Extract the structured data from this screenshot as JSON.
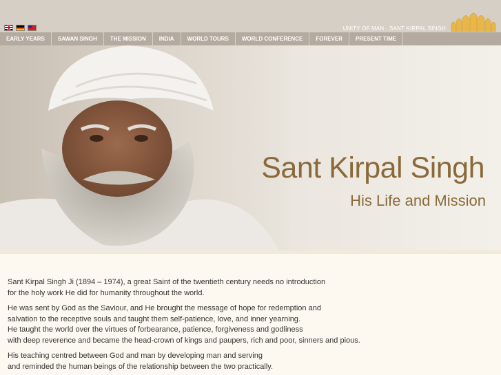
{
  "header": {
    "tagline": "UNITY OF MAN · SANT KIRPAL SINGH",
    "flags": [
      "uk-flag-icon",
      "germany-flag-icon",
      "taiwan-flag-icon"
    ]
  },
  "nav": {
    "items": [
      {
        "label": "EARLY YEARS"
      },
      {
        "label": "SAWAN SINGH"
      },
      {
        "label": "THE MISSION"
      },
      {
        "label": "INDIA"
      },
      {
        "label": "WORLD TOURS"
      },
      {
        "label": "WORLD CONFERENCE"
      },
      {
        "label": "FOREVER"
      },
      {
        "label": "PRESENT TIME"
      }
    ]
  },
  "hero": {
    "title": "Sant Kirpal Singh",
    "subtitle": "His Life and Mission"
  },
  "content": {
    "paragraphs": [
      {
        "lines": [
          "Sant Kirpal Singh Ji (1894 – 1974), a great Saint of the twentieth century needs no introduction",
          "for the holy work He did for humanity throughout the world."
        ]
      },
      {
        "lines": [
          "He was sent by God as the Saviour, and He brought the message of hope for redemption and",
          "salvation to the receptive souls and taught them self-patience, love, and inner yearning.",
          "He taught the world over the virtues of forbearance, patience, forgiveness and godliness",
          "with deep reverence and became the head-crown of kings and paupers, rich and poor, sinners and pious."
        ]
      },
      {
        "lines": [
          "His teaching centred between God and man by developing man and serving",
          "and reminded the human beings of the relationship between the two practically."
        ]
      }
    ]
  },
  "colors": {
    "header_bg": "#d6cfc5",
    "nav_bg": "#b4aa9f",
    "title_gold": "#8a6a3a",
    "page_bg": "#fdf9f1"
  }
}
